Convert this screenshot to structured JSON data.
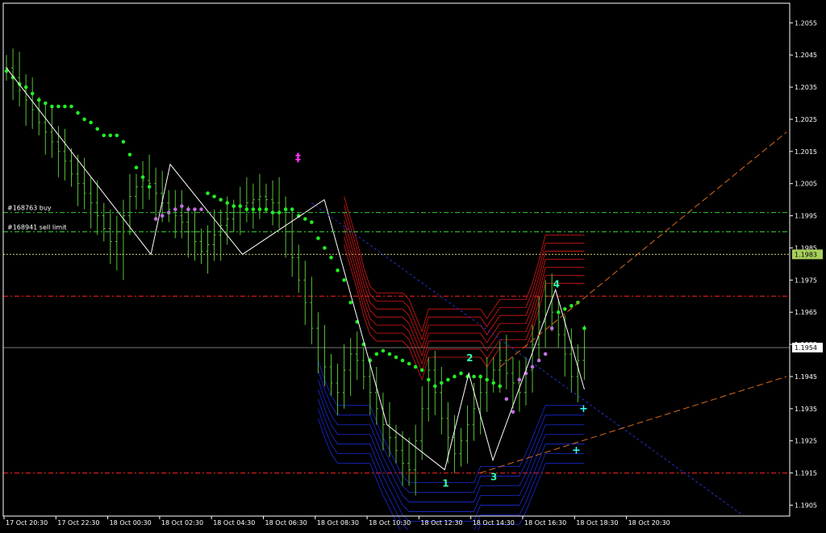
{
  "chart_data": {
    "type": "candlestick",
    "y_axis": {
      "min": 1.19,
      "max": 1.206,
      "ticks": [
        "1.2055",
        "1.2045",
        "1.2035",
        "1.2025",
        "1.2015",
        "1.2005",
        "1.1995",
        "1.1985",
        "1.1975",
        "1.1965",
        "1.1955",
        "1.1945",
        "1.1935",
        "1.1925",
        "1.1915",
        "1.1905"
      ]
    },
    "x_axis": {
      "labels": [
        "17 Oct 20:30",
        "17 Oct 22:30",
        "18 Oct 00:30",
        "18 Oct 02:30",
        "18 Oct 04:30",
        "18 Oct 06:30",
        "18 Oct 08:30",
        "18 Oct 10:30",
        "18 Oct 12:30",
        "18 Oct 14:30",
        "18 Oct 16:30",
        "18 Oct 18:30",
        "18 Oct 20:30"
      ],
      "bars_per_label": 8
    },
    "current_price": "1.1954",
    "ask_price": "1.1983",
    "orders": [
      {
        "label": "#168763 buy",
        "price": 1.1996,
        "color": "#33cc33"
      },
      {
        "label": "#168941 sell limit",
        "price": 1.199,
        "color": "#33cc33"
      }
    ],
    "levels": [
      {
        "price": 1.197,
        "color": "#ff2222"
      },
      {
        "price": 1.1915,
        "color": "#ff2222"
      }
    ],
    "closes": [
      1.2041,
      1.2038,
      1.2034,
      1.2031,
      1.2028,
      1.2024,
      1.2021,
      1.2018,
      1.2015,
      1.2012,
      1.2008,
      1.2005,
      1.2002,
      1.1999,
      1.1995,
      1.1991,
      1.1987,
      1.1983,
      1.1995,
      1.2001,
      1.2004,
      1.2006,
      1.2005,
      1.2002,
      1.1999,
      1.1997,
      1.1995,
      1.1993,
      1.199,
      1.1987,
      1.1984,
      1.1986,
      1.1989,
      1.1992,
      1.1994,
      1.1996,
      1.1998,
      1.1999,
      1.2,
      1.2001,
      1.2,
      1.1999,
      1.1996,
      1.199,
      1.1982,
      1.1975,
      1.1968,
      1.196,
      1.1954,
      1.1948,
      1.1943,
      1.194,
      1.1947,
      1.1952,
      1.195,
      1.1945,
      1.194,
      1.1935,
      1.193,
      1.1926,
      1.1922,
      1.1918,
      1.1916,
      1.1925,
      1.1935,
      1.1947,
      1.194,
      1.1932,
      1.1926,
      1.1921,
      1.1925,
      1.193,
      1.1935,
      1.194,
      1.1944,
      1.1947,
      1.195,
      1.1946,
      1.1943,
      1.194,
      1.1947,
      1.1955,
      1.1962,
      1.197,
      1.1965,
      1.1958,
      1.1952,
      1.1945,
      1.195,
      1.1954
    ],
    "sar": [
      1.204,
      1.2038,
      1.2036,
      1.2035,
      1.2033,
      1.2031,
      1.203,
      1.2029,
      1.2029,
      1.2029,
      1.2029,
      1.2027,
      1.2025,
      1.2024,
      1.2022,
      1.202,
      1.202,
      1.202,
      1.2018,
      1.2014,
      1.201,
      1.2007,
      1.2004,
      1.1994,
      1.1995,
      1.1996,
      1.1997,
      1.1998,
      1.1997,
      1.1997,
      1.1997,
      1.2002,
      1.2001,
      1.2,
      1.1999,
      1.1998,
      1.1998,
      1.1997,
      1.1997,
      1.1997,
      1.1997,
      1.1996,
      1.1996,
      1.1997,
      1.1997,
      1.1995,
      1.1994,
      1.1993,
      1.1988,
      1.1985,
      1.1982,
      1.1978,
      1.1975,
      1.1968,
      1.1962,
      1.1955,
      1.195,
      1.1952,
      1.1953,
      1.1952,
      1.1951,
      1.195,
      1.1949,
      1.1948,
      1.1947,
      1.1944,
      1.1942,
      1.1943,
      1.1944,
      1.1945,
      1.1946,
      1.1945,
      1.1945,
      1.1945,
      1.1944,
      1.1943,
      1.1942,
      1.1938,
      1.1934,
      1.1944,
      1.1946,
      1.1948,
      1.195,
      1.1952,
      1.196,
      1.1965,
      1.1966,
      1.1967,
      1.1968,
      1.196
    ],
    "sar_color": [
      1,
      1,
      1,
      1,
      1,
      1,
      1,
      1,
      1,
      1,
      1,
      1,
      1,
      1,
      1,
      1,
      1,
      1,
      1,
      1,
      1,
      1,
      1,
      0,
      0,
      0,
      0,
      0,
      0,
      0,
      0,
      1,
      1,
      1,
      1,
      1,
      1,
      1,
      1,
      1,
      1,
      1,
      1,
      1,
      1,
      1,
      1,
      1,
      1,
      1,
      1,
      1,
      1,
      1,
      1,
      1,
      1,
      1,
      1,
      1,
      1,
      1,
      1,
      1,
      1,
      1,
      1,
      1,
      1,
      1,
      1,
      1,
      1,
      1,
      1,
      1,
      1,
      0,
      0,
      0,
      0,
      0,
      0,
      0,
      0,
      1,
      1,
      1,
      1,
      1
    ],
    "zigzag": [
      [
        0,
        1.2041
      ],
      [
        30,
        1.1983
      ],
      [
        34,
        1.2011
      ],
      [
        49,
        1.1983
      ],
      [
        66,
        1.2
      ],
      [
        79,
        1.193
      ],
      [
        91,
        1.1916
      ],
      [
        96,
        1.1946
      ],
      [
        101,
        1.1919
      ],
      [
        114,
        1.1972
      ],
      [
        120,
        1.1941
      ]
    ],
    "wave_labels": [
      {
        "text": "1",
        "bar": 91,
        "price": 1.1912
      },
      {
        "text": "2",
        "bar": 96,
        "price": 1.1951
      },
      {
        "text": "3",
        "bar": 101,
        "price": 1.1914
      },
      {
        "text": "4",
        "bar": 114,
        "price": 1.1974
      }
    ]
  }
}
